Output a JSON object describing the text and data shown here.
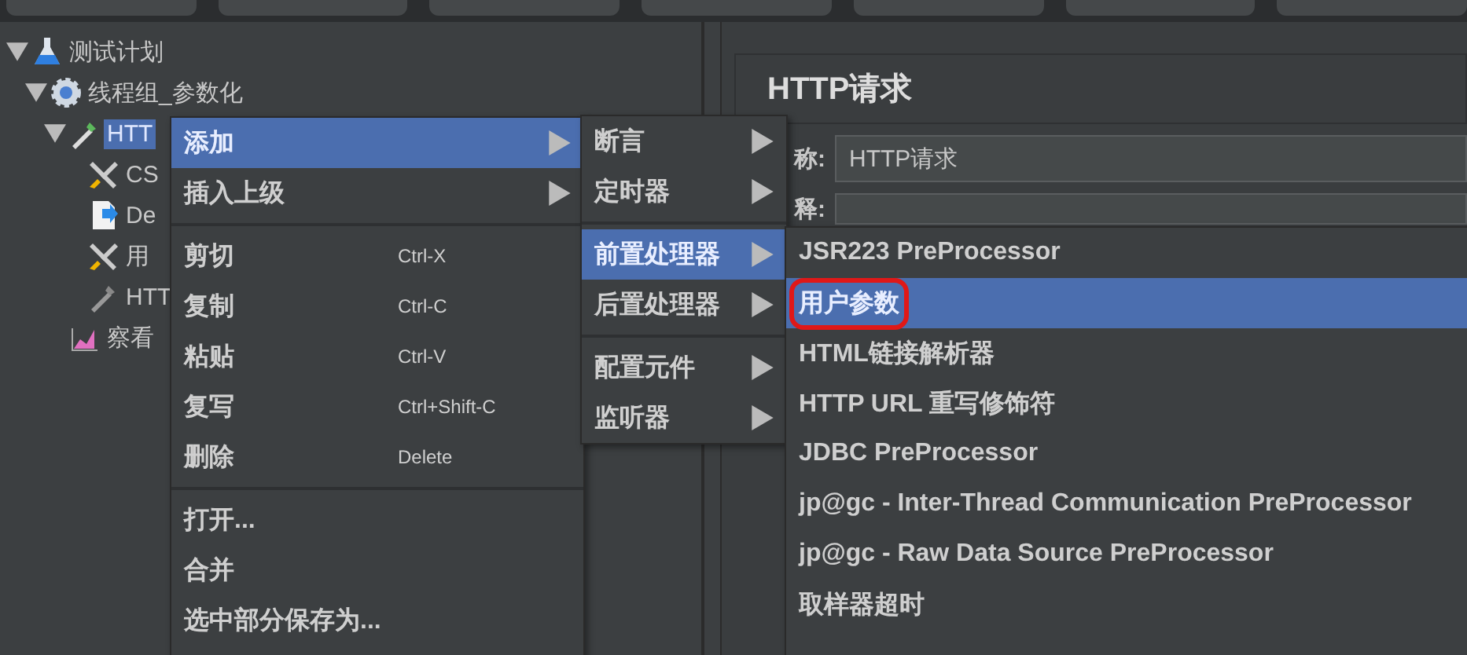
{
  "tree": [
    {
      "label": "测试计划",
      "kind": "plan",
      "selected": false,
      "expanded": true,
      "children": [
        {
          "label": "线程组_参数化",
          "kind": "group",
          "selected": false,
          "expanded": true,
          "children": [
            {
              "label": "HTT",
              "kind": "sampler",
              "selected": true,
              "expanded": true,
              "children": [
                {
                  "label": "CS",
                  "kind": "config",
                  "selected": false
                },
                {
                  "label": "De",
                  "kind": "debug",
                  "selected": false
                },
                {
                  "label": "用",
                  "kind": "preprocessor",
                  "selected": false
                },
                {
                  "label": "HTT",
                  "kind": "disabled",
                  "selected": false
                }
              ]
            },
            {
              "label": "察看",
              "kind": "listener",
              "selected": false
            }
          ]
        }
      ]
    }
  ],
  "panel": {
    "title": "HTTP请求",
    "name_label": "称:",
    "name_value": "HTTP请求",
    "comment_label": "释:"
  },
  "context_menu": [
    [
      {
        "label": "添加",
        "submenu": true,
        "selected": true
      },
      {
        "label": "插入上级",
        "submenu": true,
        "selected": false
      }
    ],
    [
      {
        "label": "剪切",
        "shortcut": "Ctrl-X",
        "selected": false
      },
      {
        "label": "复制",
        "shortcut": "Ctrl-C",
        "selected": false
      },
      {
        "label": "粘贴",
        "shortcut": "Ctrl-V",
        "selected": false
      },
      {
        "label": "复写",
        "shortcut": "Ctrl+Shift-C",
        "selected": false
      },
      {
        "label": "删除",
        "shortcut": "Delete",
        "selected": false
      }
    ],
    [
      {
        "label": "打开...",
        "selected": false
      },
      {
        "label": "合并",
        "selected": false
      },
      {
        "label": "选中部分保存为...",
        "selected": false
      }
    ]
  ],
  "add_submenu": [
    [
      {
        "label": "断言",
        "selected": false
      },
      {
        "label": "定时器",
        "selected": false
      }
    ],
    [
      {
        "label": "前置处理器",
        "selected": true
      },
      {
        "label": "后置处理器",
        "selected": false
      }
    ],
    [
      {
        "label": "配置元件",
        "selected": false
      },
      {
        "label": "监听器",
        "selected": false
      }
    ]
  ],
  "preprocessor_menu": [
    {
      "label": "JSR223 PreProcessor",
      "selected": false,
      "annotated": false
    },
    {
      "label": "用户参数",
      "selected": true,
      "annotated": true
    },
    {
      "label": "HTML链接解析器",
      "selected": false,
      "annotated": false
    },
    {
      "label": "HTTP URL 重写修饰符",
      "selected": false,
      "annotated": false
    },
    {
      "label": "JDBC PreProcessor",
      "selected": false,
      "annotated": false
    },
    {
      "label": "jp@gc - Inter-Thread Communication PreProcessor",
      "selected": false,
      "annotated": false
    },
    {
      "label": "jp@gc - Raw Data Source PreProcessor",
      "selected": false,
      "annotated": false
    },
    {
      "label": "取样器超时",
      "selected": false,
      "annotated": false
    }
  ]
}
